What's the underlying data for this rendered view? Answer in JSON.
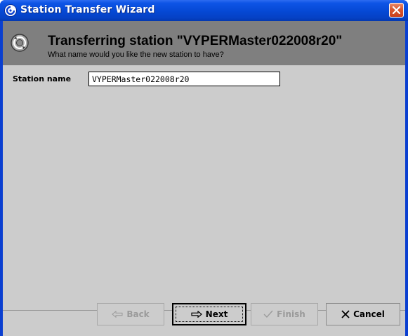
{
  "window": {
    "title": "Station Transfer Wizard",
    "icons": {
      "app": "niagara-app-icon",
      "close": "close-icon"
    }
  },
  "header": {
    "title": "Transferring station \"VYPERMaster022008r20\"",
    "subtitle": "What name would you like the new station to have?",
    "icon": "transfer-wizard-icon"
  },
  "form": {
    "station_name_label": "Station name",
    "station_name_value": "VYPERMaster022008r20"
  },
  "buttons": {
    "back": {
      "label": "Back",
      "icon": "arrow-left-icon",
      "enabled": false
    },
    "next": {
      "label": "Next",
      "icon": "arrow-right-icon",
      "enabled": true
    },
    "finish": {
      "label": "Finish",
      "icon": "check-icon",
      "enabled": false
    },
    "cancel": {
      "label": "Cancel",
      "icon": "close-x-icon",
      "enabled": true
    }
  },
  "colors": {
    "titlebar": "#0548d4",
    "header_bg": "#7f7f7f",
    "content_bg": "#cccccc",
    "close_button": "#d9572f"
  }
}
